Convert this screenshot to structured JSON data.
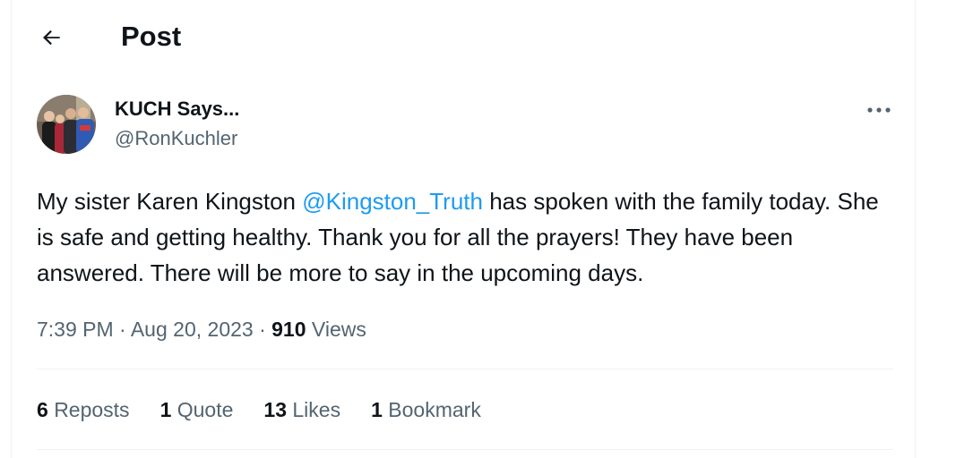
{
  "header": {
    "title": "Post",
    "back_icon": "arrow-left-icon"
  },
  "author": {
    "name": "KUCH Says...",
    "handle": "@RonKuchler"
  },
  "tweet": {
    "text_before": "My sister Karen Kingston ",
    "mention": "@Kingston_Truth",
    "text_after": " has spoken with the family today. She is safe and getting healthy. Thank you for all the prayers! They have been answered. There will be more to say in the upcoming days."
  },
  "meta": {
    "time": "7:39 PM",
    "separator": "·",
    "date": "Aug 20, 2023",
    "views_count": "910",
    "views_label": "Views"
  },
  "stats": {
    "reposts_count": "6",
    "reposts_label": "Reposts",
    "quotes_count": "1",
    "quotes_label": "Quote",
    "likes_count": "13",
    "likes_label": "Likes",
    "bookmarks_count": "1",
    "bookmarks_label": "Bookmark"
  },
  "colors": {
    "text_primary": "#0f1419",
    "text_secondary": "#536471",
    "link": "#1d9bf0",
    "divider": "#eff3f4"
  }
}
